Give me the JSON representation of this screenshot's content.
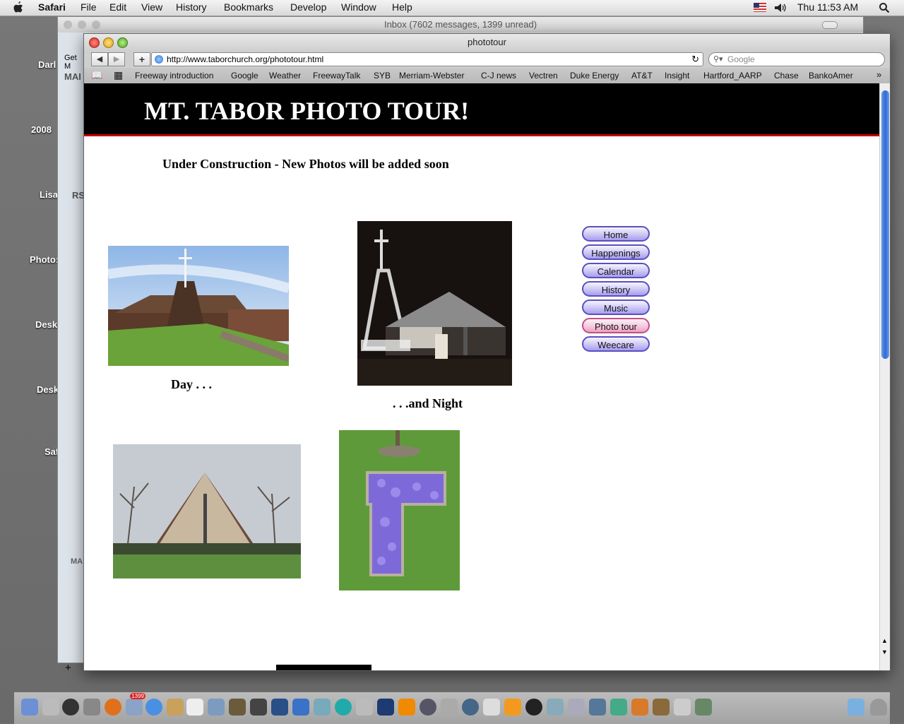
{
  "menubar": {
    "app": "Safari",
    "items": [
      "File",
      "Edit",
      "View",
      "History",
      "Bookmarks",
      "Develop",
      "Window",
      "Help"
    ],
    "clock": "Thu 11:53 AM"
  },
  "desktop": {
    "labels": [
      "Darl",
      "2008",
      "Lisa",
      "Photo:",
      "Desk",
      "Desk",
      "Saf"
    ]
  },
  "mail_window": {
    "title": "Inbox (7602 messages, 1399 unread)",
    "sidebar_fragments": [
      "Get M",
      "MAI",
      "RS",
      "MA"
    ]
  },
  "safari": {
    "title": "phototour",
    "url": "http://www.taborchurch.org/phototour.html",
    "search_placeholder": "Google",
    "bookmarks": [
      "Freeway introduction",
      "Google",
      "Weather",
      "FreewayTalk",
      "SYB",
      "Merriam-Webster",
      "C-J news",
      "Vectren",
      "Duke Energy",
      "AT&T",
      "Insight",
      "Hartford_AARP",
      "Chase",
      "BankoAmer"
    ]
  },
  "page": {
    "banner_title": "MT. TABOR PHOTO TOUR!",
    "notice": "Under Construction - New Photos will be added soon",
    "captions": {
      "day": "Day . . .",
      "night": ". . .and Night"
    },
    "nav": [
      {
        "label": "Home",
        "active": false
      },
      {
        "label": "Happenings",
        "active": false
      },
      {
        "label": "Calendar",
        "active": false
      },
      {
        "label": "History",
        "active": false
      },
      {
        "label": "Music",
        "active": false
      },
      {
        "label": "Photo tour",
        "active": true
      },
      {
        "label": "Weecare",
        "active": false
      }
    ],
    "accent_colors": {
      "banner": "#000000",
      "rule": "#c00000"
    }
  },
  "dock": {
    "mail_badge": "1399"
  }
}
